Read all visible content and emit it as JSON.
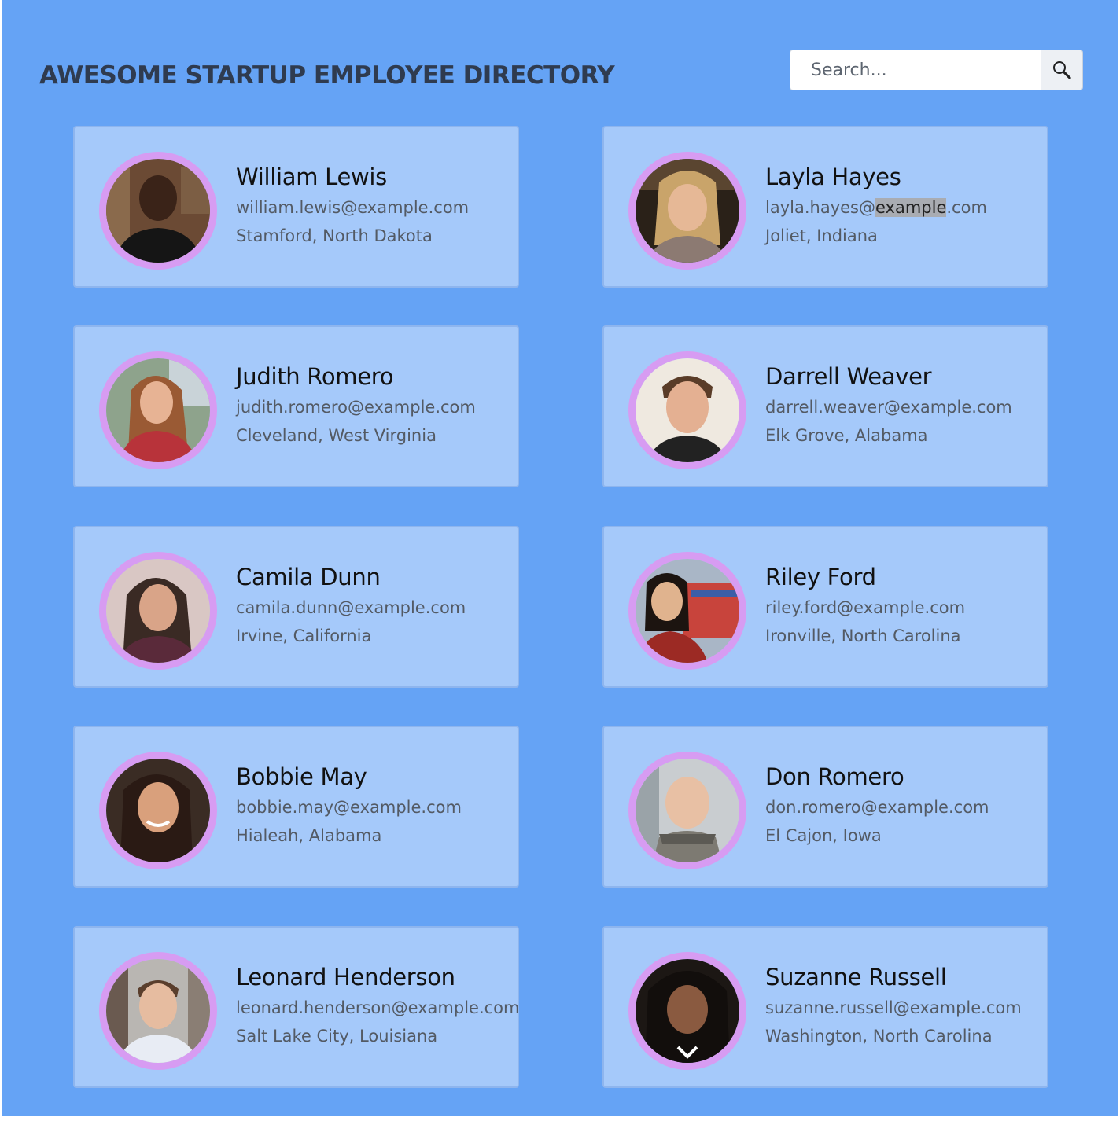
{
  "header": {
    "title": "AWESOME STARTUP EMPLOYEE DIRECTORY"
  },
  "search": {
    "placeholder": "Search...",
    "icon": "magnifier-icon"
  },
  "colors": {
    "background": "#65a3f5",
    "card": "#a5c9fa",
    "avatar_ring": "#d79cf2"
  },
  "employees": [
    {
      "name": "William Lewis",
      "email": "william.lewis@example.com",
      "location": "Stamford, North Dakota"
    },
    {
      "name": "Layla Hayes",
      "email_before": "layla.hayes@",
      "email_highlight": "example",
      "email_after": ".com",
      "location": "Joliet, Indiana"
    },
    {
      "name": "Judith Romero",
      "email": "judith.romero@example.com",
      "location": "Cleveland, West Virginia"
    },
    {
      "name": "Darrell Weaver",
      "email": "darrell.weaver@example.com",
      "location": "Elk Grove, Alabama"
    },
    {
      "name": "Camila Dunn",
      "email": "camila.dunn@example.com",
      "location": "Irvine, California"
    },
    {
      "name": "Riley Ford",
      "email": "riley.ford@example.com",
      "location": "Ironville, North Carolina"
    },
    {
      "name": "Bobbie May",
      "email": "bobbie.may@example.com",
      "location": "Hialeah, Alabama"
    },
    {
      "name": "Don Romero",
      "email": "don.romero@example.com",
      "location": "El Cajon, Iowa"
    },
    {
      "name": "Leonard Henderson",
      "email": "leonard.henderson@example.com",
      "location": "Salt Lake City, Louisiana"
    },
    {
      "name": "Suzanne Russell",
      "email": "suzanne.russell@example.com",
      "location": "Washington, North Carolina"
    }
  ]
}
